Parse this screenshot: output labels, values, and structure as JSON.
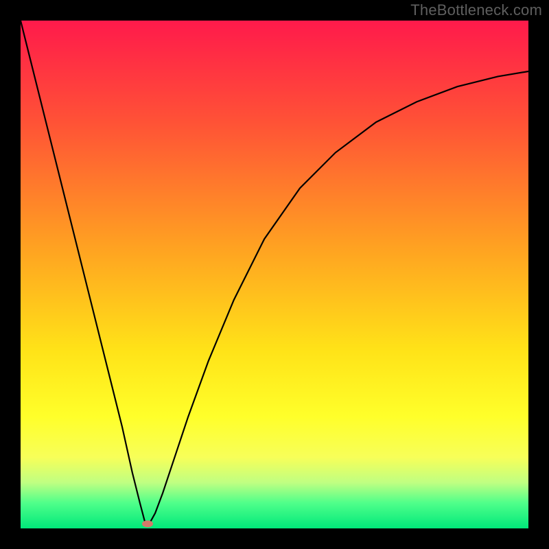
{
  "watermark": "TheBottleneck.com",
  "chart_data": {
    "type": "line",
    "title": "",
    "xlabel": "",
    "ylabel": "",
    "xlim": [
      0,
      100
    ],
    "ylim": [
      0,
      100
    ],
    "background_gradient": {
      "stops": [
        {
          "offset": 0,
          "color": "#ff1a4b"
        },
        {
          "offset": 20,
          "color": "#ff5236"
        },
        {
          "offset": 45,
          "color": "#ffa321"
        },
        {
          "offset": 65,
          "color": "#ffe318"
        },
        {
          "offset": 78,
          "color": "#ffff2a"
        },
        {
          "offset": 86,
          "color": "#f7ff59"
        },
        {
          "offset": 91,
          "color": "#bfff82"
        },
        {
          "offset": 95,
          "color": "#4fff8a"
        },
        {
          "offset": 100,
          "color": "#00e87a"
        }
      ]
    },
    "curve_points": [
      {
        "x": 0,
        "y": 100
      },
      {
        "x": 2,
        "y": 92
      },
      {
        "x": 5,
        "y": 80
      },
      {
        "x": 8,
        "y": 68
      },
      {
        "x": 11,
        "y": 56
      },
      {
        "x": 14,
        "y": 44
      },
      {
        "x": 17,
        "y": 32
      },
      {
        "x": 20,
        "y": 20
      },
      {
        "x": 22,
        "y": 11
      },
      {
        "x": 23.5,
        "y": 5
      },
      {
        "x": 24.5,
        "y": 1.2
      },
      {
        "x": 25,
        "y": 0.8
      },
      {
        "x": 25.5,
        "y": 1.2
      },
      {
        "x": 26.5,
        "y": 3
      },
      {
        "x": 28,
        "y": 7
      },
      {
        "x": 30,
        "y": 13
      },
      {
        "x": 33,
        "y": 22
      },
      {
        "x": 37,
        "y": 33
      },
      {
        "x": 42,
        "y": 45
      },
      {
        "x": 48,
        "y": 57
      },
      {
        "x": 55,
        "y": 67
      },
      {
        "x": 62,
        "y": 74
      },
      {
        "x": 70,
        "y": 80
      },
      {
        "x": 78,
        "y": 84
      },
      {
        "x": 86,
        "y": 87
      },
      {
        "x": 94,
        "y": 89
      },
      {
        "x": 100,
        "y": 90
      }
    ],
    "marker": {
      "x": 25,
      "y": 0.9,
      "color": "#d47a6a"
    },
    "line_color": "#000000"
  }
}
